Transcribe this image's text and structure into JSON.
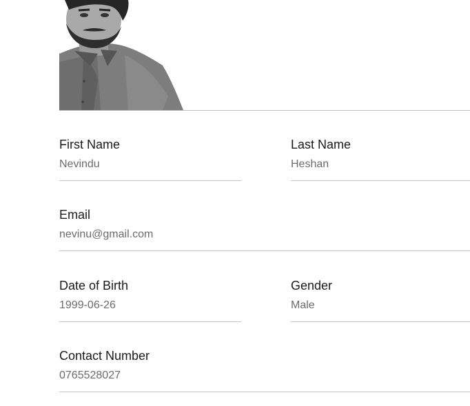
{
  "form": {
    "first_name": {
      "label": "First Name",
      "value": "Nevindu"
    },
    "last_name": {
      "label": "Last Name",
      "value": "Heshan"
    },
    "email": {
      "label": "Email",
      "value": "nevinu@gmail.com"
    },
    "date_of_birth": {
      "label": "Date of Birth",
      "value": "1999-06-26"
    },
    "gender": {
      "label": "Gender",
      "value": "Male"
    },
    "contact_number": {
      "label": "Contact Number",
      "value": "0765528027"
    }
  },
  "colors": {
    "label": "#1a1a1a",
    "value": "#6b6b6b",
    "underline": "#c4c4c4"
  }
}
